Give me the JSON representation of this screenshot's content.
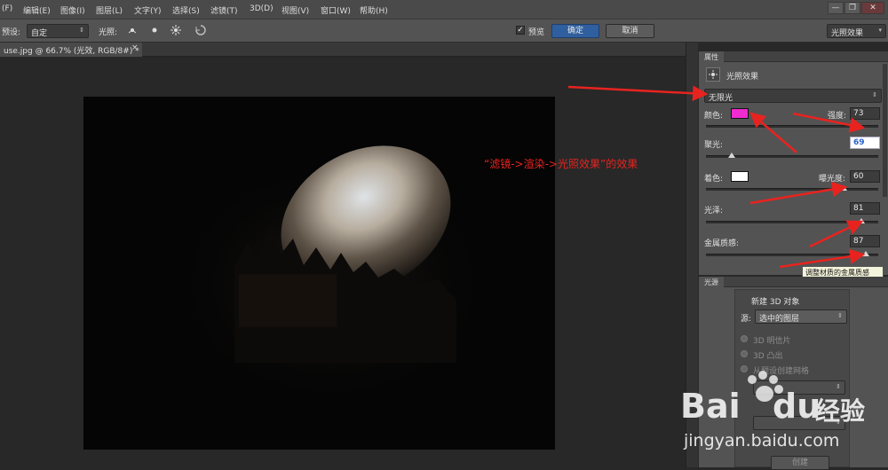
{
  "menubar": {
    "items": [
      "(F)",
      "编辑(E)",
      "图像(I)",
      "图层(L)",
      "文字(Y)",
      "选择(S)",
      "滤镜(T)",
      "3D(D)",
      "视图(V)",
      "窗口(W)",
      "帮助(H)"
    ],
    "window_buttons": [
      "—",
      "❐",
      "✕"
    ]
  },
  "options": {
    "preset_label": "预设:",
    "preset_value": "自定",
    "light_label": "光照:",
    "preview_label": "预览",
    "ok_label": "确定",
    "cancel_label": "取消",
    "workspace_value": "光照效果"
  },
  "document": {
    "tab_title": "use.jpg @ 66.7% (光效, RGB/8#) *",
    "close": "×"
  },
  "properties": {
    "tab_label": "属性",
    "title": "光照效果",
    "light_type": "无限光",
    "color_label": "颜色:",
    "color_value": "#f02bd0",
    "intensity_label": "强度:",
    "intensity_value": "73",
    "hotspot_label": "聚光:",
    "hotspot_value": "69",
    "colorize_label": "着色:",
    "colorize_value": "#ffffff",
    "exposure_label": "曝光度:",
    "exposure_value": "60",
    "gloss_label": "光泽:",
    "gloss_value": "81",
    "metallic_label": "金属质感:",
    "metallic_value": "87",
    "tooltip": "调整材质的金属质感",
    "levels": {
      "intensity": 0.86,
      "hotspot": 0.15,
      "exposure": 0.8,
      "gloss": 0.9,
      "metallic": 0.93
    }
  },
  "annotation": "“滤镜->渲染->光照效果”的效果",
  "lights_panel": {
    "tab_label": "光源",
    "title": "新建 3D 对象",
    "source_label": "源:",
    "source_value": "选中的图层",
    "option_postcard": "3D 明信片",
    "option_extrude": "3D 凸出",
    "option_mesh": "从预设创建网格",
    "create_label": "创建"
  },
  "watermark": {
    "brand": "Bai",
    "brand2": "du",
    "suffix": "经验",
    "url": "jingyan.baidu.com"
  },
  "colors": {
    "accent_button": "#2f5f9e",
    "annotation_red": "#e8231f"
  }
}
